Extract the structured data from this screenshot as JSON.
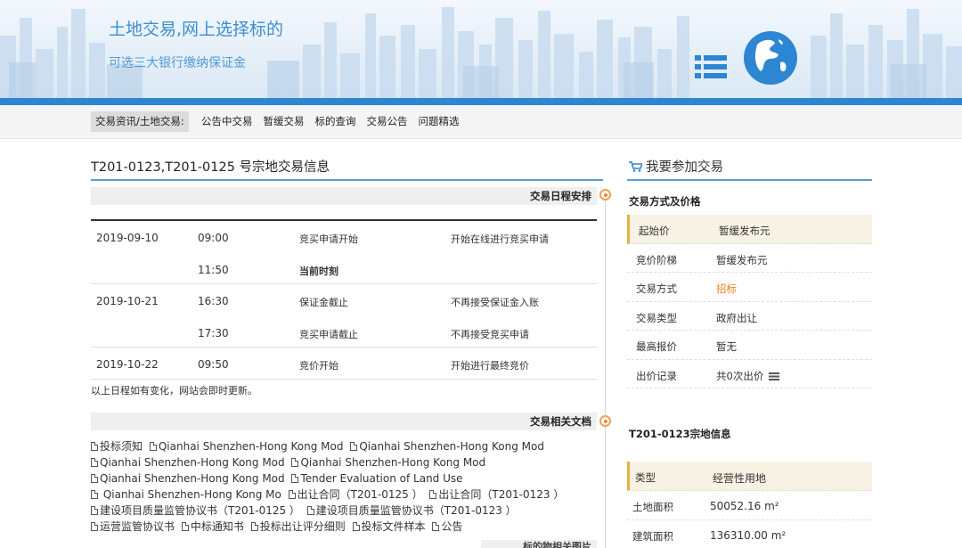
{
  "banner": {
    "title": "土地交易,网上选择标的",
    "subtitle": "可选三大银行缴纳保证金"
  },
  "nav": {
    "current": "交易资讯/土地交易:",
    "links": [
      "公告中交易",
      "暂缓交易",
      "标的查询",
      "交易公告",
      "问题精选"
    ]
  },
  "left": {
    "title": "T201-0123,T201-0125 号宗地交易信息",
    "schedule_header": "交易日程安排",
    "schedule": [
      {
        "date": "2019-09-10",
        "time": "09:00",
        "event": "竞买申请开始",
        "note": "开始在线进行竞买申请"
      },
      {
        "date": "",
        "time": "11:50",
        "event": "当前时刻",
        "note": ""
      },
      {
        "date": "2019-10-21",
        "time": "16:30",
        "event": "保证金截止",
        "note": "不再接受保证金入账"
      },
      {
        "date": "",
        "time": "17:30",
        "event": "竞买申请截止",
        "note": "不再接受竞买申请"
      },
      {
        "date": "2019-10-22",
        "time": "09:50",
        "event": "竞价开始",
        "note": "开始进行最终竞价"
      }
    ],
    "schedule_note": "以上日程如有变化，网站会即时更新。",
    "docs_header": "交易相关文档",
    "docs": [
      "投标须知",
      "Qianhai Shenzhen-Hong Kong Mod",
      "Qianhai Shenzhen-Hong Kong Mod",
      "Qianhai Shenzhen-Hong Kong Mod",
      "Qianhai Shenzhen-Hong Kong Mod",
      "Qianhai Shenzhen-Hong Kong Mod",
      "Tender Evaluation of Land Use",
      " Qianhai Shenzhen-Hong Kong Mo",
      "出让合同（T201-0125 ）",
      "出让合同（T201-0123 ）",
      "建设项目质量监管协议书（T201-0125 ）",
      "建设项目质量监管协议书（T201-0123 ）",
      "运营监管协议书",
      "中标通知书",
      "投标出让评分细则",
      "投标文件样本",
      "公告"
    ],
    "bottom_header": "标的物相关图片"
  },
  "right": {
    "title": "我要参加交易",
    "section1": "交易方式及价格",
    "price_rows": [
      {
        "key": "起始价",
        "value": "暂缓发布元"
      },
      {
        "key": "竞价阶梯",
        "value": "暂缓发布元"
      },
      {
        "key": "交易方式",
        "value": "招标"
      },
      {
        "key": "交易类型",
        "value": "政府出让"
      },
      {
        "key": "最高报价",
        "value": "暂无"
      },
      {
        "key": "出价记录",
        "value": "共0次出价"
      }
    ],
    "section2": "T201-0123宗地信息",
    "land_rows": [
      {
        "key": "类型",
        "value": "经营性用地"
      },
      {
        "key": "土地面积",
        "value": "50052.16 m²"
      },
      {
        "key": "建筑面积",
        "value": "136310.00 m²"
      }
    ]
  },
  "colors": {
    "accent_blue": "#2c86d1",
    "orange": "#f07f1a",
    "highlight": "#e3b33c"
  }
}
